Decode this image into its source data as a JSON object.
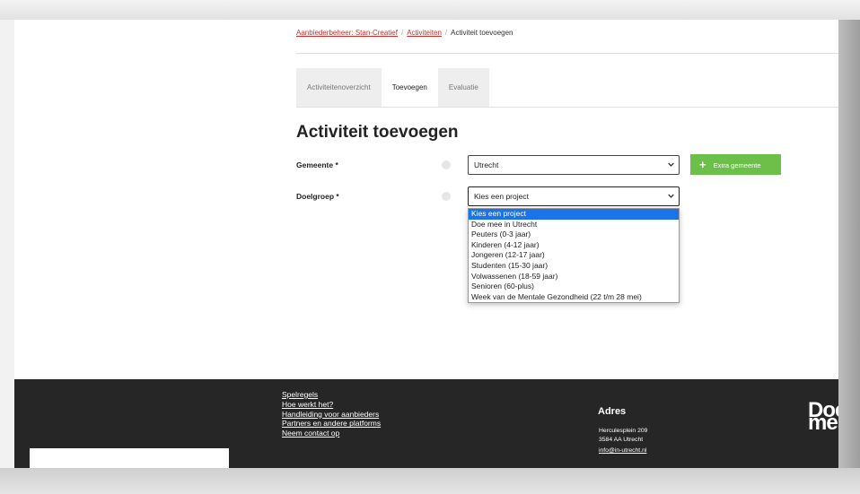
{
  "breadcrumb": {
    "item1": "Aanbiederbeheer: Stan-Creatief",
    "item2": "Activiteiten",
    "current": "Activiteit toevoegen",
    "separator": "/"
  },
  "tabs": [
    {
      "label": "Activiteitenoverzicht"
    },
    {
      "label": "Toevoegen"
    },
    {
      "label": "Evaluatie"
    }
  ],
  "page_title": "Activiteit toevoegen",
  "form": {
    "gemeente_label": "Gemeente *",
    "gemeente_value": "Utrecht",
    "extra_gemeente_label": "Extra gemeente",
    "doelgroep_label": "Doelgroep *",
    "doelgroep_value": "Kies een project"
  },
  "doelgroep_options": [
    "Kies een project",
    "Doe mee in Utrecht",
    "Peuters (0-3 jaar)",
    "Kinderen (4-12 jaar)",
    "Jongeren (12-17 jaar)",
    "Studenten (15-30 jaar)",
    "Volwassenen (18-59 jaar)",
    "Senioren (60-plus)",
    "Week van de Mentale Gezondheid (22 t/m 28 mei)"
  ],
  "footer": {
    "links": [
      "Spelregels",
      "Hoe werkt het?",
      "Handleiding voor aanbieders",
      "Partners en andere platforms",
      "Neem contact op"
    ],
    "address_title": "Adres",
    "address_street": "Herculesplein 209",
    "address_city": "3584 AA Utrecht",
    "address_email": "info@in-utrecht.nl",
    "logo_line1": "Doe",
    "logo_line2": "me"
  },
  "colors": {
    "link_red": "#c9302c",
    "button_green": "#6cc04a",
    "selected_option": "#1a73e8",
    "footer_bg": "#262626"
  }
}
